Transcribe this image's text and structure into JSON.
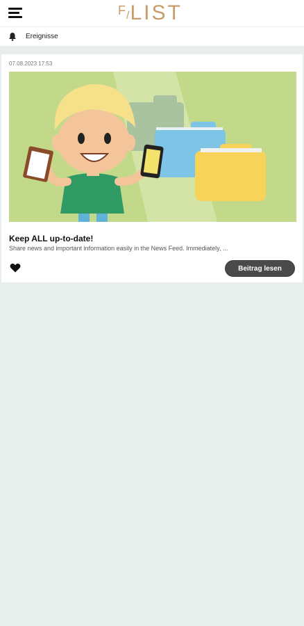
{
  "header": {
    "logo_prefix": "F",
    "logo_text": "LIST"
  },
  "filter": {
    "label": "Ereignisse",
    "icon": "bell-icon"
  },
  "post": {
    "date": "07.08.2023 17:53",
    "title": "Keep ALL up-to-date!",
    "excerpt": "Share news and important information easily in the News Feed. Immediately, ...",
    "read_button": "Beitrag lesen",
    "like_icon": "heart-icon"
  },
  "colors": {
    "logo": "#c99b6a",
    "button": "#4a4a4a",
    "page_bg": "#e7eeec",
    "illustration_bg": "#c3d98a"
  }
}
